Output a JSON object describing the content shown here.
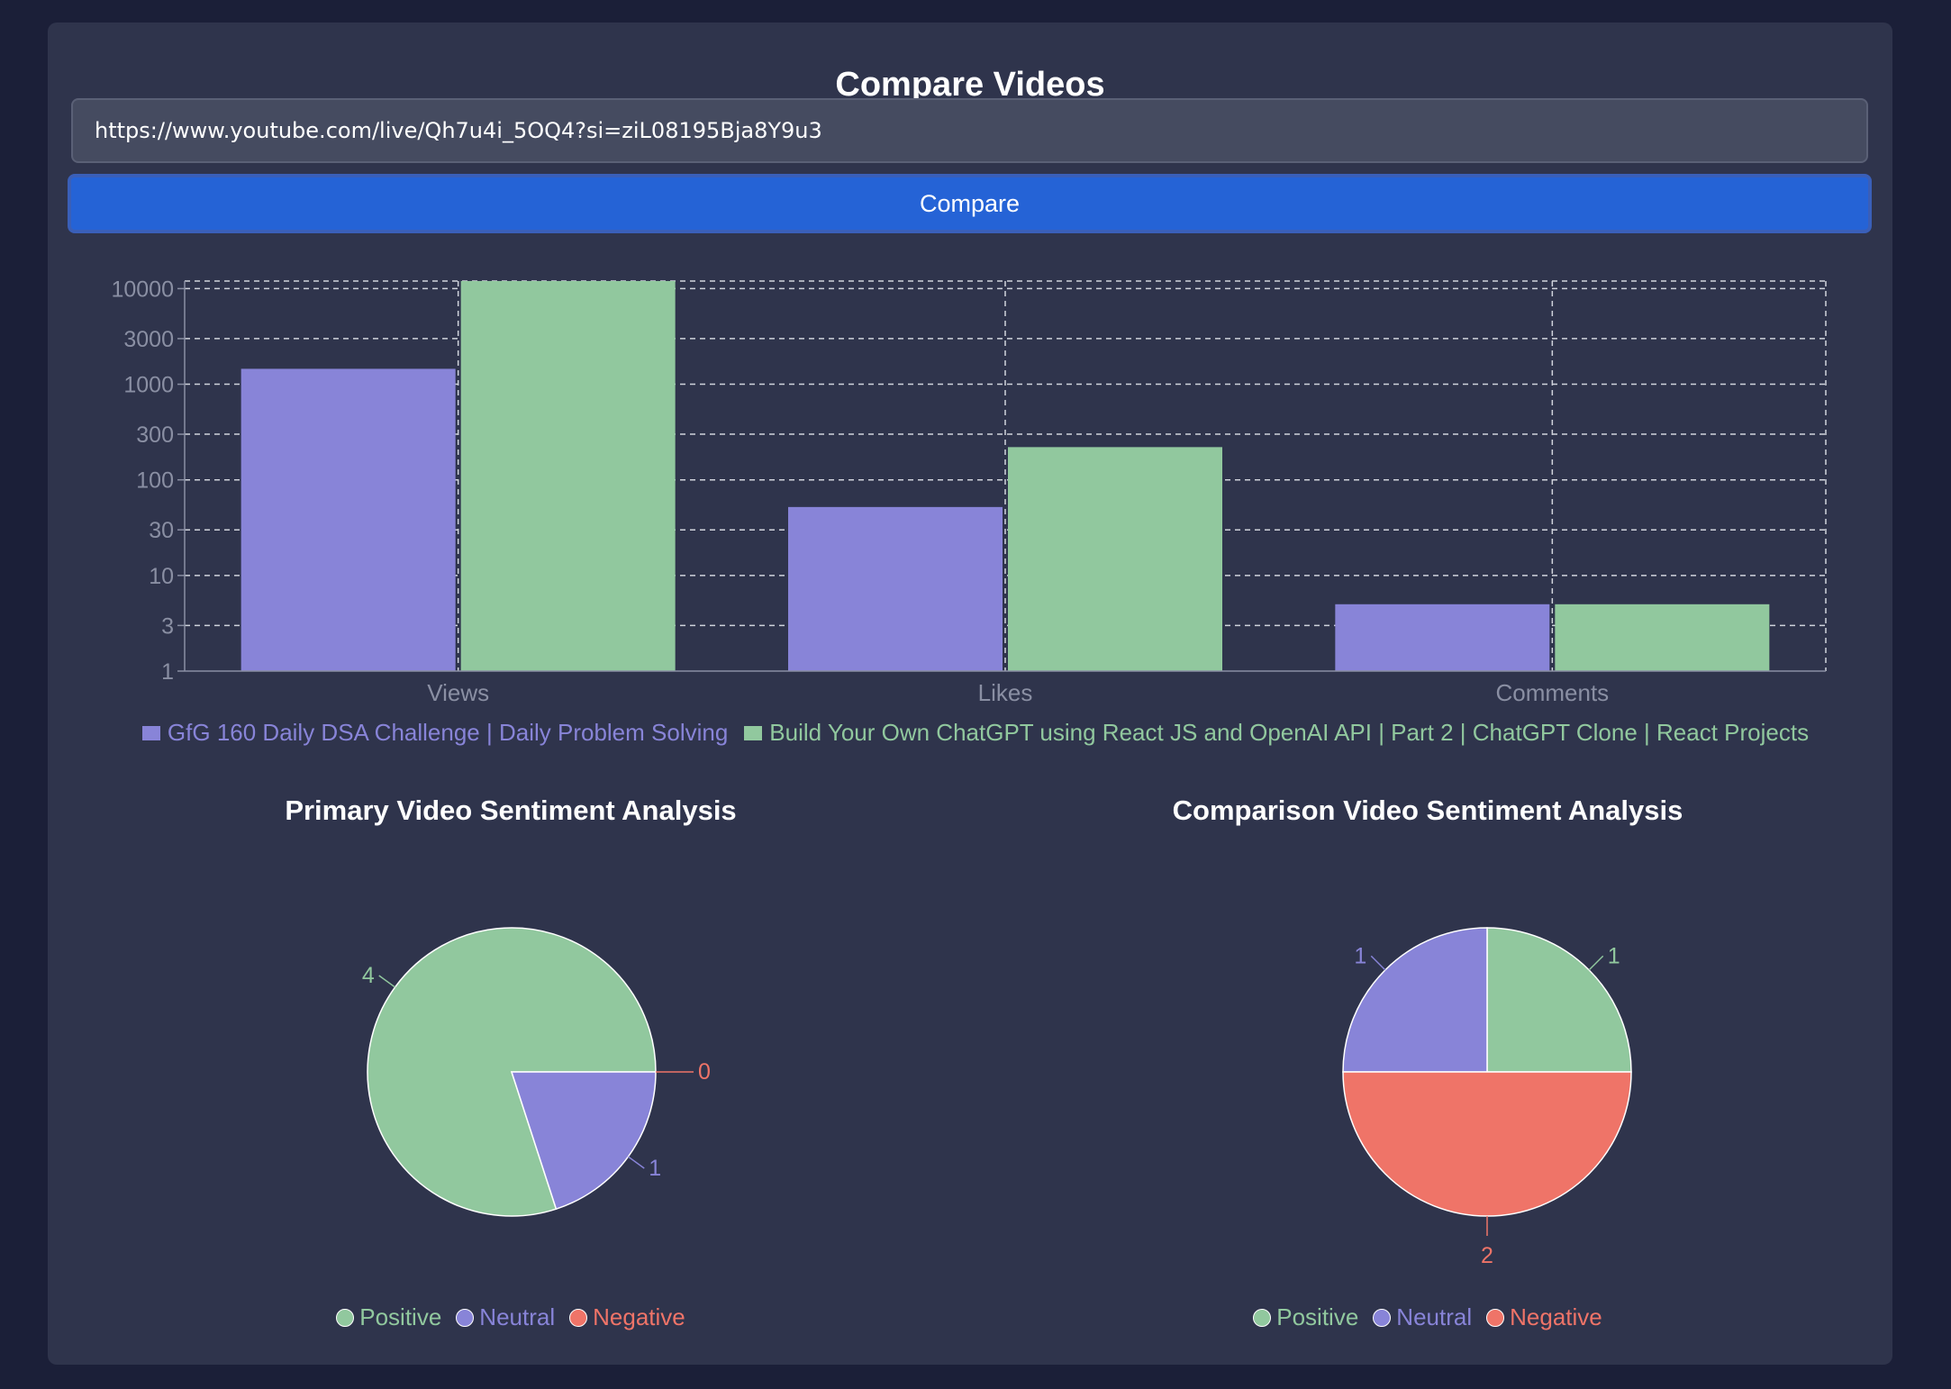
{
  "header": {
    "title": "Compare Videos"
  },
  "form": {
    "url_value": "https://www.youtube.com/live/Qh7u4i_5OQ4?si=ziL08195Bja8Y9u3",
    "compare_label": "Compare"
  },
  "colors": {
    "primary": "#8884d8",
    "comparison": "#91c89e",
    "positive": "#91c89e",
    "neutral": "#8884d8",
    "negative": "#ef7468",
    "button": "#2563d6"
  },
  "bar_legend": {
    "primary": "GfG 160 Daily DSA Challenge | Daily Problem Solving",
    "comparison": "Build Your Own ChatGPT using React JS and OpenAI API | Part 2 | ChatGPT Clone | React Projects"
  },
  "pies": {
    "primary_title": "Primary Video Sentiment Analysis",
    "comparison_title": "Comparison Video Sentiment Analysis",
    "legend": {
      "positive": "Positive",
      "neutral": "Neutral",
      "negative": "Negative"
    }
  },
  "chart_data": [
    {
      "type": "bar",
      "scale": "log",
      "grid": true,
      "legend_position": "bottom",
      "categories": [
        "Views",
        "Likes",
        "Comments"
      ],
      "yticks": [
        "1",
        "3",
        "10",
        "30",
        "100",
        "300",
        "1000",
        "3000",
        "10000"
      ],
      "ylim": [
        1,
        12000
      ],
      "series": [
        {
          "name": "GfG 160 Daily DSA Challenge | Daily Problem Solving",
          "values": [
            1450,
            52,
            5
          ]
        },
        {
          "name": "Build Your Own ChatGPT using React JS and OpenAI API | Part 2 | ChatGPT Clone | React Projects",
          "values": [
            12000,
            220,
            5
          ]
        }
      ]
    },
    {
      "type": "pie",
      "title": "Primary Video Sentiment Analysis",
      "labels": [
        "Positive",
        "Neutral",
        "Negative"
      ],
      "values": [
        4,
        1,
        0
      ]
    },
    {
      "type": "pie",
      "title": "Comparison Video Sentiment Analysis",
      "labels": [
        "Positive",
        "Neutral",
        "Negative"
      ],
      "values": [
        1,
        1,
        2
      ]
    }
  ]
}
